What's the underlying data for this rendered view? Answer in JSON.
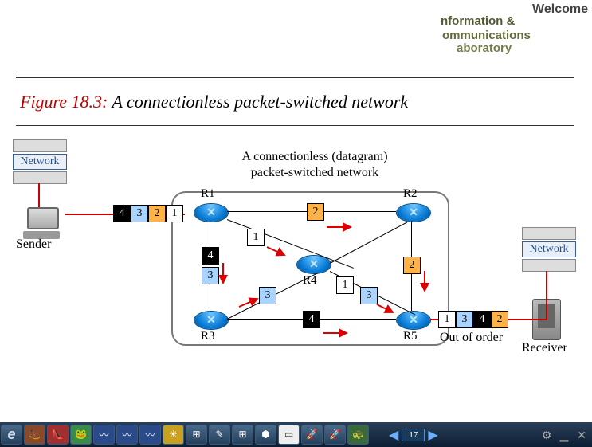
{
  "banner": {
    "welcome": "Welcome",
    "line1": "nformation &",
    "line2": "ommunications",
    "line3": "aboratory"
  },
  "title": {
    "figure": "Figure 18.3:",
    "caption": " A connectionless packet-switched network"
  },
  "diagram": {
    "caption1": "A connectionless (datagram)",
    "caption2": "packet-switched network",
    "network_label": "Network",
    "sender": "Sender",
    "receiver": "Receiver",
    "out_of_order": "Out of order",
    "routers": [
      "R1",
      "R2",
      "R3",
      "R4",
      "R5"
    ],
    "packets_sender": [
      "4",
      "3",
      "2",
      "1"
    ],
    "packets_receiver": [
      "1",
      "3",
      "4",
      "2"
    ],
    "inner_packets": {
      "top2": "2",
      "mid1": "1",
      "left4": "4",
      "left3": "3",
      "right2": "2",
      "r3r4_3": "3",
      "r4r5_1": "1",
      "r4r5_3": "3",
      "bottom4": "4"
    }
  },
  "nav": {
    "page": "17"
  }
}
